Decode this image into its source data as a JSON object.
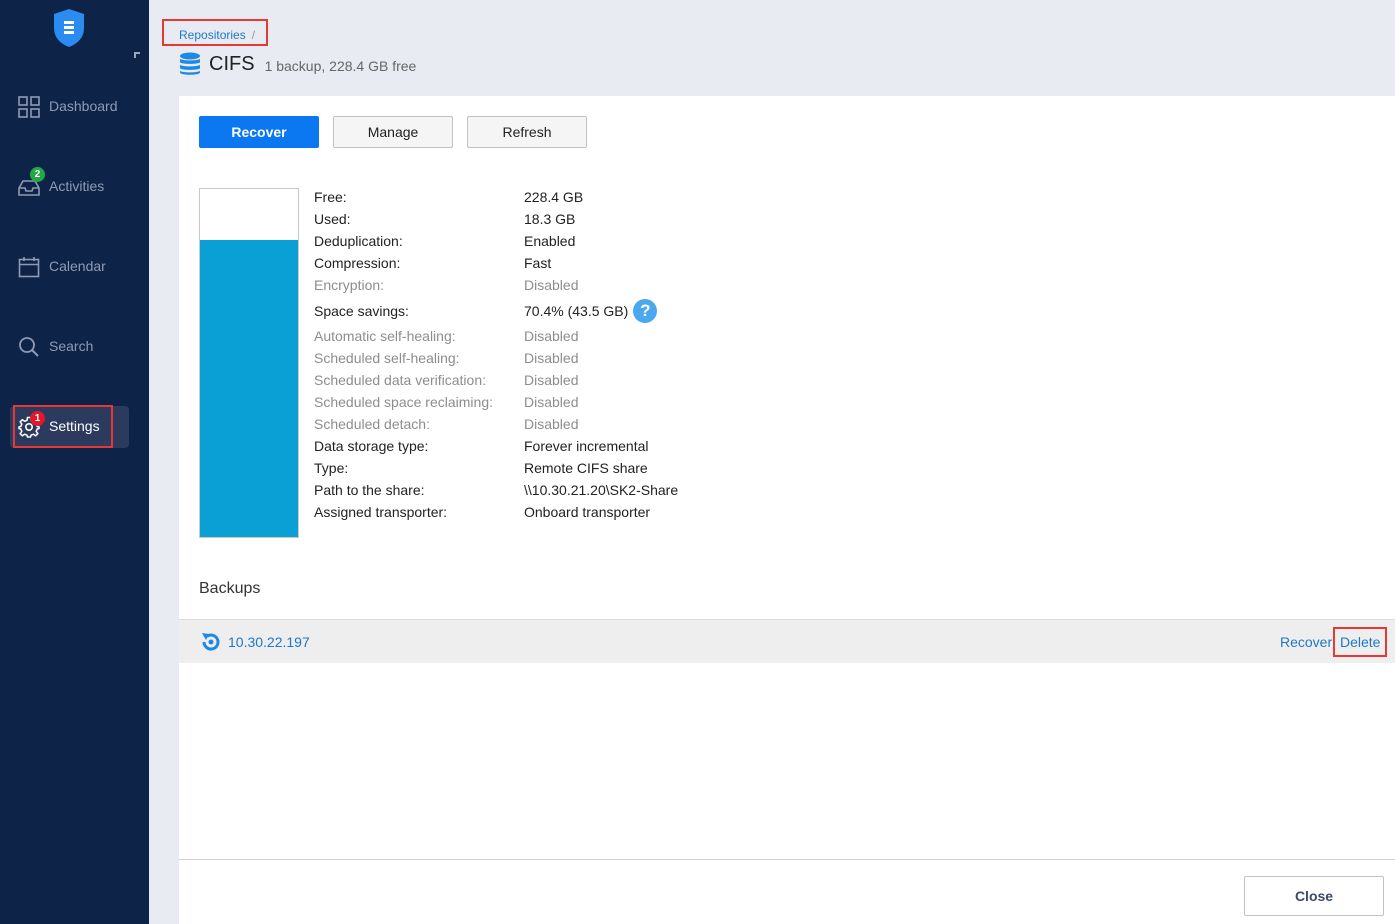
{
  "sidebar": {
    "items": [
      {
        "label": "Dashboard",
        "icon": "dashboard-icon"
      },
      {
        "label": "Activities",
        "icon": "inbox-icon",
        "badge": "2"
      },
      {
        "label": "Calendar",
        "icon": "calendar-icon"
      },
      {
        "label": "Search",
        "icon": "search-icon"
      },
      {
        "label": "Settings",
        "icon": "gear-icon",
        "badge": "1",
        "active": true
      }
    ]
  },
  "header": {
    "breadcrumb": "Repositories",
    "breadcrumb_separator": "/",
    "title": "CIFS",
    "subtitle": "1 backup, 228.4 GB free"
  },
  "toolbar": {
    "recover_label": "Recover",
    "manage_label": "Manage",
    "refresh_label": "Refresh"
  },
  "storage": {
    "used_fraction": 0.854
  },
  "properties": [
    {
      "key": "Free:",
      "value": "228.4 GB"
    },
    {
      "key": "Used:",
      "value": "18.3 GB"
    },
    {
      "key": "Deduplication:",
      "value": "Enabled"
    },
    {
      "key": "Compression:",
      "value": "Fast"
    },
    {
      "key": "Encryption:",
      "value": "Disabled"
    },
    {
      "key": "Space savings:",
      "value": "70.4% (43.5 GB)"
    },
    {
      "key": "Automatic self-healing:",
      "value": "Disabled"
    },
    {
      "key": "Scheduled self-healing:",
      "value": "Disabled"
    },
    {
      "key": "Scheduled data verification:",
      "value": "Disabled"
    },
    {
      "key": "Scheduled space reclaiming:",
      "value": "Disabled"
    },
    {
      "key": "Scheduled detach:",
      "value": "Disabled"
    },
    {
      "key": "Data storage type:",
      "value": "Forever incremental"
    },
    {
      "key": "Type:",
      "value": "Remote CIFS share"
    },
    {
      "key": "Path to the share:",
      "value": "\\\\10.30.21.20\\SK2-Share"
    },
    {
      "key": "Assigned transporter:",
      "value": "Onboard transporter"
    }
  ],
  "help_glyph": "?",
  "backups": {
    "heading": "Backups",
    "rows": [
      {
        "name": "10.30.22.197",
        "recover_label": "Recover",
        "delete_label": "Delete"
      }
    ]
  },
  "footer": {
    "close_label": "Close"
  },
  "colors": {
    "sidebar_bg": "#0d2348",
    "accent": "#0b78f2",
    "storage_used": "#0aa0d6",
    "link": "#1e78c8",
    "highlight": "#e53935"
  }
}
